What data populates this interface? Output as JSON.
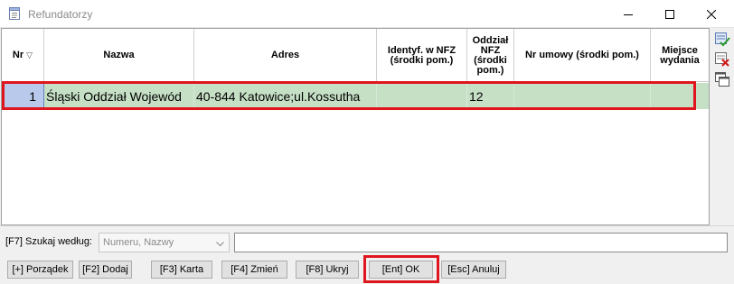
{
  "window": {
    "title": "Refundatorzy",
    "icon": "notebook-icon"
  },
  "columns": [
    "Nr",
    "Nazwa",
    "Adres",
    "Identyf. w NFZ (środki pom.)",
    "Oddział NFZ (środki pom.)",
    "Nr umowy (środki pom.)",
    "Miejsce wydania"
  ],
  "header": {
    "nr": "Nr",
    "sort_indicator": "▽",
    "nazwa": "Nazwa",
    "adres": "Adres",
    "identyf_l1": "Identyf. w NFZ",
    "identyf_l2": "(środki pom.)",
    "oddzial_l1": "Oddział",
    "oddzial_l2": "NFZ",
    "oddzial_l3": "(środki",
    "oddzial_l4": "pom.)",
    "nr_umowy": "Nr umowy (środki pom.)",
    "miejsce_l1": "Miejsce",
    "miejsce_l2": "wydania"
  },
  "rows": [
    {
      "nr": "1",
      "nazwa": "Śląski Oddział Wojewód",
      "adres": "40-844 Katowice;ul.Kossutha",
      "identyf": "",
      "oddzial": "12",
      "nr_umowy": "",
      "miejsce": ""
    }
  ],
  "side_toolbar": [
    "select-check-icon",
    "delete-icon",
    "windows-icon"
  ],
  "search": {
    "label": "[F7] Szukaj według:",
    "combo_value": "Numeru, Nazwy",
    "input_value": ""
  },
  "buttons": {
    "porzadek": "[+] Porządek",
    "dodaj": "[F2] Dodaj",
    "karta": "[F3] Karta",
    "zmien": "[F4] Zmień",
    "ukryj": "[F8] Ukryj",
    "ok": "[Ent] OK",
    "anuluj": "[Esc] Anuluj"
  },
  "colors": {
    "selected_row": "#c6e0c6",
    "highlight_frame": "#e0161e"
  }
}
